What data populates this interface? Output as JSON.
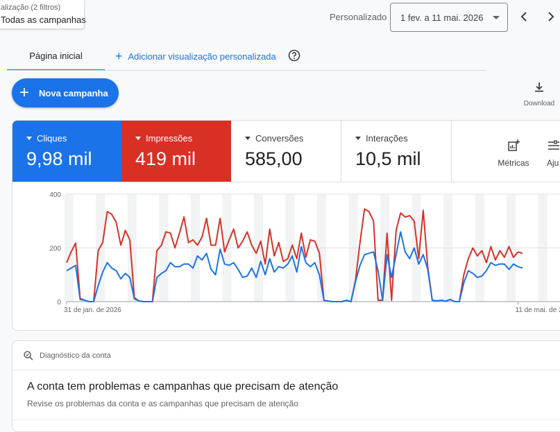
{
  "filter": {
    "line1": "alização (2 filtros)",
    "line2": "Todas as campanhas"
  },
  "period": {
    "label": "Personalizado",
    "range": "1 fev. a 11 mai. 2026"
  },
  "tabs": {
    "home": "Página inicial",
    "add_view": "Adicionar visualização personalizada"
  },
  "actions": {
    "new_campaign": "Nova campanha",
    "download": "Download"
  },
  "scorecards": [
    {
      "name": "Cliques",
      "value": "9,98 mil",
      "color": "#1a73e8"
    },
    {
      "name": "Impressões",
      "value": "419 mil",
      "color": "#d93025"
    },
    {
      "name": "Conversões",
      "value": "585,00",
      "color": "#ffffff"
    },
    {
      "name": "Interações",
      "value": "10,5 mil",
      "color": "#ffffff"
    }
  ],
  "tools": {
    "metrics": "Métricas",
    "adjust": "Aju"
  },
  "chart_data": {
    "type": "line",
    "x": [
      "2026-01-31",
      "2026-02-01",
      "2026-02-02",
      "2026-02-03",
      "2026-02-04",
      "2026-02-05",
      "2026-02-06",
      "2026-02-07",
      "2026-02-08",
      "2026-02-09",
      "2026-02-10",
      "2026-02-11",
      "2026-02-12",
      "2026-02-13",
      "2026-02-14",
      "2026-02-15",
      "2026-02-16",
      "2026-02-17",
      "2026-02-18",
      "2026-02-19",
      "2026-02-20",
      "2026-02-21",
      "2026-02-22",
      "2026-02-23",
      "2026-02-24",
      "2026-02-25",
      "2026-02-26",
      "2026-02-27",
      "2026-02-28",
      "2026-03-01",
      "2026-03-02",
      "2026-03-03",
      "2026-03-04",
      "2026-03-05",
      "2026-03-06",
      "2026-03-07",
      "2026-03-08",
      "2026-03-09",
      "2026-03-10",
      "2026-03-11",
      "2026-03-12",
      "2026-03-13",
      "2026-03-14",
      "2026-03-15",
      "2026-03-16",
      "2026-03-17",
      "2026-03-18",
      "2026-03-19",
      "2026-03-20",
      "2026-03-21",
      "2026-03-22",
      "2026-03-23",
      "2026-03-24",
      "2026-03-25",
      "2026-03-26",
      "2026-03-27",
      "2026-03-28",
      "2026-03-29",
      "2026-03-30",
      "2026-03-31",
      "2026-04-01",
      "2026-04-02",
      "2026-04-03",
      "2026-04-04",
      "2026-04-05",
      "2026-04-06",
      "2026-04-07",
      "2026-04-08",
      "2026-04-09",
      "2026-04-10",
      "2026-04-11",
      "2026-04-12",
      "2026-04-13",
      "2026-04-14",
      "2026-04-15",
      "2026-04-16",
      "2026-04-17",
      "2026-04-18",
      "2026-04-19",
      "2026-04-20",
      "2026-04-21",
      "2026-04-22",
      "2026-04-23",
      "2026-04-24",
      "2026-04-25",
      "2026-04-26",
      "2026-04-27",
      "2026-04-28",
      "2026-04-29",
      "2026-04-30",
      "2026-05-01",
      "2026-05-02",
      "2026-05-03",
      "2026-05-04",
      "2026-05-05",
      "2026-05-06",
      "2026-05-07",
      "2026-05-08",
      "2026-05-09",
      "2026-05-10",
      "2026-05-11",
      "2026-05-12",
      "2026-05-13",
      "2026-05-14",
      "2026-05-15",
      "2026-05-16",
      "2026-05-17",
      "2026-05-18",
      "2026-05-19",
      "2026-05-20",
      "2026-05-21",
      "2026-05-22"
    ],
    "series": [
      {
        "color": "#d93025",
        "values": [
          145,
          185,
          218,
          12,
          5,
          0,
          0,
          190,
          220,
          335,
          325,
          295,
          210,
          265,
          230,
          15,
          3,
          0,
          0,
          0,
          190,
          210,
          260,
          255,
          200,
          255,
          315,
          220,
          230,
          210,
          240,
          310,
          210,
          210,
          310,
          185,
          230,
          270,
          200,
          225,
          260,
          210,
          180,
          225,
          140,
          270,
          170,
          220,
          150,
          160,
          210,
          160,
          255,
          165,
          230,
          225,
          180,
          5,
          2,
          0,
          0,
          0,
          5,
          0,
          80,
          220,
          345,
          335,
          300,
          5,
          5,
          255,
          5,
          265,
          330,
          315,
          320,
          300,
          160,
          340,
          130,
          5,
          3,
          5,
          2,
          8,
          0,
          0,
          100,
          160,
          200,
          170,
          190,
          145,
          205,
          155,
          190,
          165,
          205,
          165,
          185,
          180
        ]
      },
      {
        "color": "#1a73e8",
        "values": [
          115,
          125,
          135,
          8,
          5,
          0,
          0,
          60,
          110,
          145,
          125,
          115,
          85,
          105,
          90,
          10,
          3,
          0,
          0,
          0,
          90,
          105,
          115,
          145,
          130,
          130,
          140,
          140,
          125,
          170,
          155,
          180,
          120,
          100,
          195,
          140,
          135,
          145,
          120,
          90,
          95,
          125,
          90,
          150,
          100,
          160,
          110,
          130,
          125,
          140,
          170,
          110,
          205,
          145,
          130,
          145,
          100,
          5,
          2,
          0,
          0,
          0,
          5,
          0,
          75,
          135,
          175,
          180,
          185,
          115,
          5,
          175,
          90,
          175,
          260,
          185,
          160,
          200,
          140,
          175,
          120,
          5,
          3,
          5,
          2,
          8,
          0,
          0,
          70,
          115,
          105,
          90,
          95,
          115,
          145,
          135,
          140,
          140,
          120,
          140,
          130,
          125
        ]
      }
    ],
    "ylim": [
      0,
      400
    ],
    "yticks": [
      "0",
      "200",
      "400"
    ],
    "xtick_labels": [
      "31 de jan. de 2026",
      "11 de mai. de 2026"
    ],
    "grid": true
  },
  "diagnostics": {
    "header": "Diagnóstico da conta",
    "title": "A conta tem problemas e campanhas que precisam de atenção",
    "subtitle": "Revise os problemas da conta e as campanhas que precisam de atenção"
  }
}
